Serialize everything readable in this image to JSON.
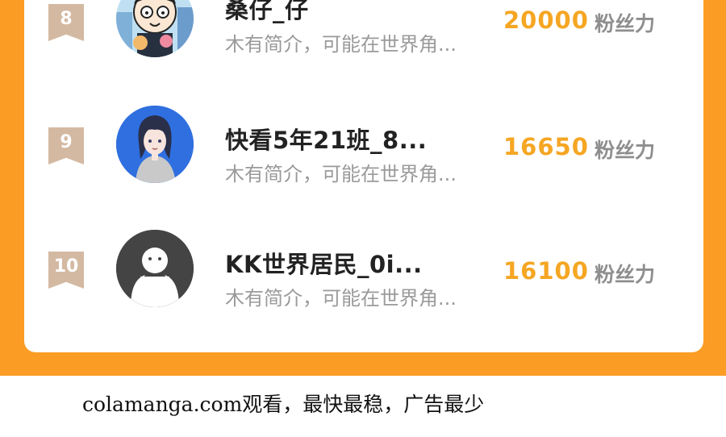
{
  "ranking": [
    {
      "rank": "8",
      "name": "桑仔_仔",
      "intro": "木有简介，可能在世界角...",
      "fans": "20000",
      "fans_label": "粉丝力",
      "avatar": "cartoon-boy-avatar"
    },
    {
      "rank": "9",
      "name": "快看5年21班_8...",
      "intro": "木有简介，可能在世界角...",
      "fans": "16650",
      "fans_label": "粉丝力",
      "avatar": "anime-girl-avatar"
    },
    {
      "rank": "10",
      "name": "KK世界居民_0i...",
      "intro": "木有简介，可能在世界角...",
      "fans": "16100",
      "fans_label": "粉丝力",
      "avatar": "default-user-avatar"
    }
  ],
  "footer": {
    "text": "colamanga.com观看，最快最稳，广告最少"
  },
  "colors": {
    "background_band": "#fb9c24",
    "fans_value": "#f5a623",
    "rank_badge": "#d4b9a2",
    "avatar_default_bg": "#444444",
    "avatar_blue_bg": "#2f6fe0"
  }
}
